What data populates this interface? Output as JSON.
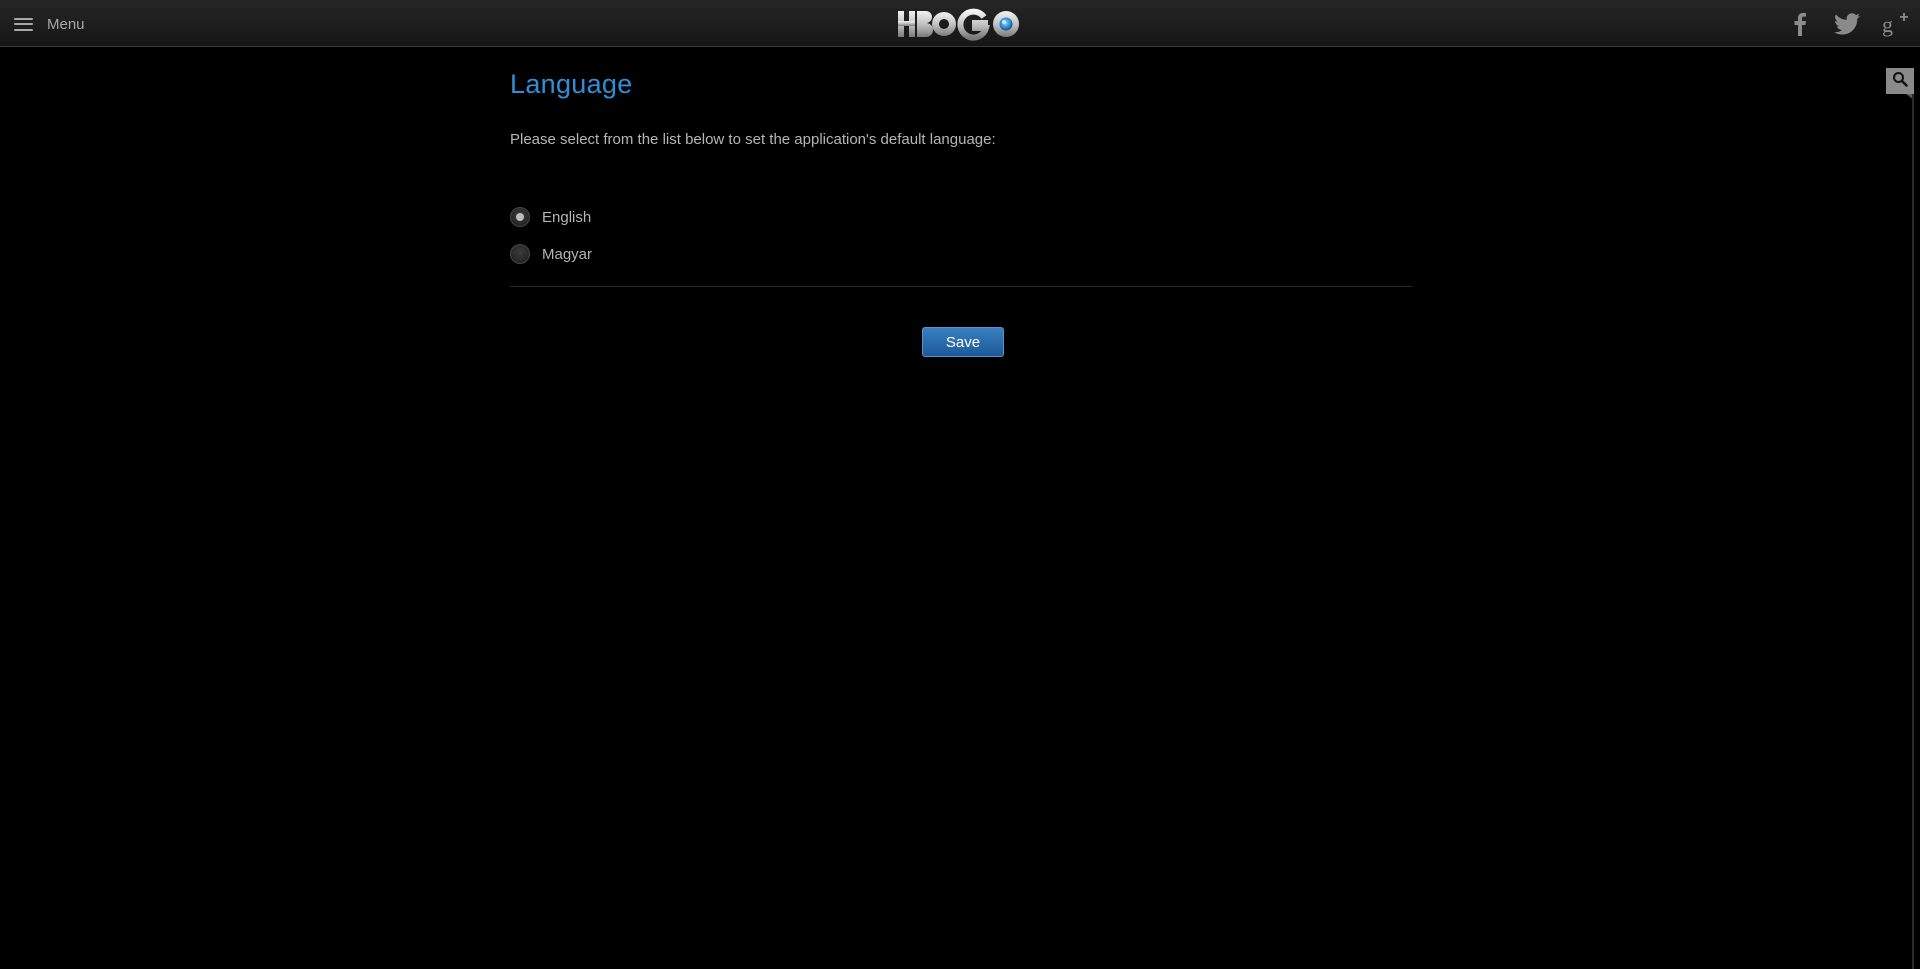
{
  "header": {
    "menu_label": "Menu",
    "logo_text": "HBO GO",
    "social": [
      "facebook-icon",
      "twitter-icon",
      "google-plus-icon"
    ]
  },
  "main": {
    "title": "Language",
    "description": "Please select from the list below to set the application's default language:",
    "languages": [
      {
        "label": "English",
        "selected": true
      },
      {
        "label": "Magyar",
        "selected": false
      }
    ],
    "save_label": "Save"
  },
  "colors": {
    "accent": "#2f8fd6",
    "button": "#2a6eb0",
    "background": "#000000"
  }
}
